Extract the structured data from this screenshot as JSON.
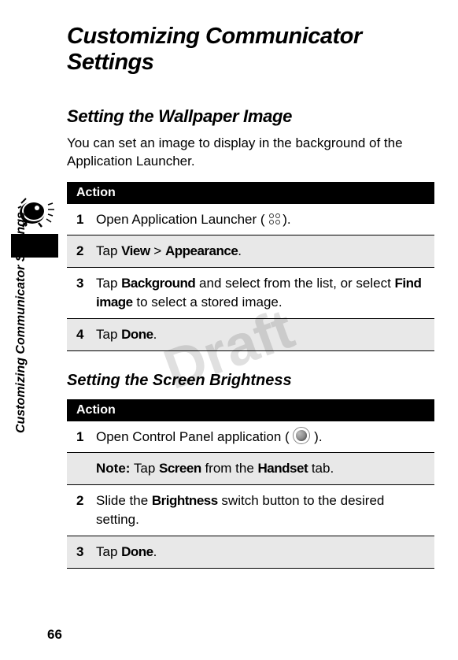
{
  "watermark": "Draft",
  "side_label": "Customizing Communicator Settings",
  "page_number": "66",
  "main_title": "Customizing Communicator Settings",
  "section1": {
    "title": "Setting the Wallpaper Image",
    "intro": "You can set an image to display in the background of the Application Launcher.",
    "action_header": "Action",
    "steps": [
      {
        "num": "1",
        "pre": "Open Application Launcher ( ",
        "post": ").",
        "icon": "four-dots"
      },
      {
        "num": "2",
        "pre": "Tap ",
        "ui1": "View",
        "mid": " > ",
        "ui2": "Appearance",
        "post": "."
      },
      {
        "num": "3",
        "pre": "Tap ",
        "ui1": "Background",
        "mid": " and select from the list, or select ",
        "ui2": "Find image",
        "post": " to select a stored image."
      },
      {
        "num": "4",
        "pre": "Tap ",
        "ui1": "Done",
        "post": "."
      }
    ]
  },
  "section2": {
    "title": "Setting the Screen Brightness",
    "action_header": "Action",
    "steps": [
      {
        "num": "1",
        "pre": "Open Control Panel application ( ",
        "post": " ).",
        "icon": "gear"
      },
      {
        "note": true,
        "notelabel": "Note:",
        "pre": " Tap ",
        "ui1": "Screen",
        "mid": " from the ",
        "ui2": "Handset",
        "post": " tab."
      },
      {
        "num": "2",
        "pre": "Slide the ",
        "ui1": "Brightness",
        "post": " switch button to the desired setting."
      },
      {
        "num": "3",
        "pre": "Tap ",
        "ui1": "Done",
        "post": "."
      }
    ]
  }
}
